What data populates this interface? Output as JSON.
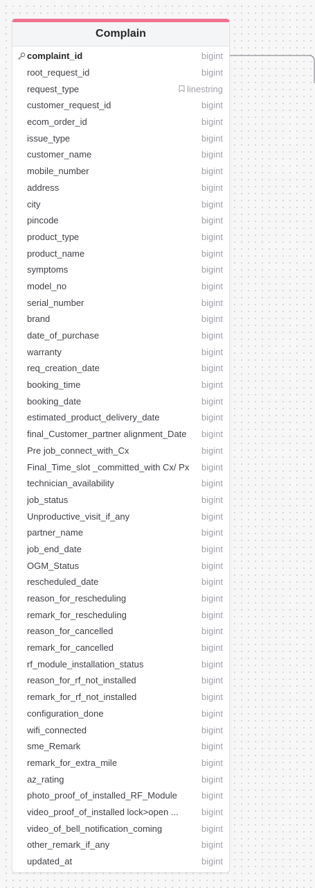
{
  "table": {
    "title": "Complain",
    "accent_color": "#f0728f",
    "fields": [
      {
        "name": "complaint_id",
        "type": "bigint",
        "pk": true
      },
      {
        "name": "root_request_id",
        "type": "bigint"
      },
      {
        "name": "request_type",
        "type": "linestring",
        "note": true
      },
      {
        "name": "customer_request_id",
        "type": "bigint"
      },
      {
        "name": "ecom_order_id",
        "type": "bigint"
      },
      {
        "name": "issue_type",
        "type": "bigint"
      },
      {
        "name": "customer_name",
        "type": "bigint"
      },
      {
        "name": "mobile_number",
        "type": "bigint"
      },
      {
        "name": "address",
        "type": "bigint"
      },
      {
        "name": "city",
        "type": "bigint"
      },
      {
        "name": "pincode",
        "type": "bigint"
      },
      {
        "name": "product_type",
        "type": "bigint"
      },
      {
        "name": "product_name",
        "type": "bigint"
      },
      {
        "name": "symptoms",
        "type": "bigint"
      },
      {
        "name": "model_no",
        "type": "bigint"
      },
      {
        "name": "serial_number",
        "type": "bigint"
      },
      {
        "name": "brand",
        "type": "bigint"
      },
      {
        "name": "date_of_purchase",
        "type": "bigint"
      },
      {
        "name": "warranty",
        "type": "bigint"
      },
      {
        "name": "req_creation_date",
        "type": "bigint"
      },
      {
        "name": "booking_time",
        "type": "bigint"
      },
      {
        "name": "booking_date",
        "type": "bigint"
      },
      {
        "name": "estimated_product_delivery_date",
        "type": "bigint"
      },
      {
        "name": "final_Customer_partner alignment_Date",
        "type": "bigint"
      },
      {
        "name": "Pre job_connect_with_Cx",
        "type": "bigint"
      },
      {
        "name": "Final_Time_slot _committed_with Cx/ Px",
        "type": "bigint"
      },
      {
        "name": "technician_availability",
        "type": "bigint"
      },
      {
        "name": "job_status",
        "type": "bigint"
      },
      {
        "name": "Unproductive_visit_if_any",
        "type": "bigint"
      },
      {
        "name": "partner_name",
        "type": "bigint"
      },
      {
        "name": "job_end_date",
        "type": "bigint"
      },
      {
        "name": "OGM_Status",
        "type": "bigint"
      },
      {
        "name": "rescheduled_date",
        "type": "bigint"
      },
      {
        "name": "reason_for_rescheduling",
        "type": "bigint"
      },
      {
        "name": "remark_for_rescheduling",
        "type": "bigint"
      },
      {
        "name": "reason_for_cancelled",
        "type": "bigint"
      },
      {
        "name": "remark_for_cancelled",
        "type": "bigint"
      },
      {
        "name": "rf_module_installation_status",
        "type": "bigint"
      },
      {
        "name": "reason_for_rf_not_installed",
        "type": "bigint"
      },
      {
        "name": "remark_for_rf_not_installed",
        "type": "bigint"
      },
      {
        "name": "configuration_done",
        "type": "bigint"
      },
      {
        "name": "wifi_connected",
        "type": "bigint"
      },
      {
        "name": "sme_Remark",
        "type": "bigint"
      },
      {
        "name": "remark_for_extra_mile",
        "type": "bigint"
      },
      {
        "name": "az_rating",
        "type": "bigint"
      },
      {
        "name": "photo_proof_of_installed_RF_Module",
        "type": "bigint"
      },
      {
        "name": "video_proof_of_installed lock>open ...",
        "type": "bigint"
      },
      {
        "name": "video_of_bell_notification_coming",
        "type": "bigint"
      },
      {
        "name": "other_remark_if_any",
        "type": "bigint"
      },
      {
        "name": "updated_at",
        "type": "bigint"
      }
    ]
  },
  "icons": {
    "primary_key": "key-icon",
    "note": "bookmark-icon"
  }
}
